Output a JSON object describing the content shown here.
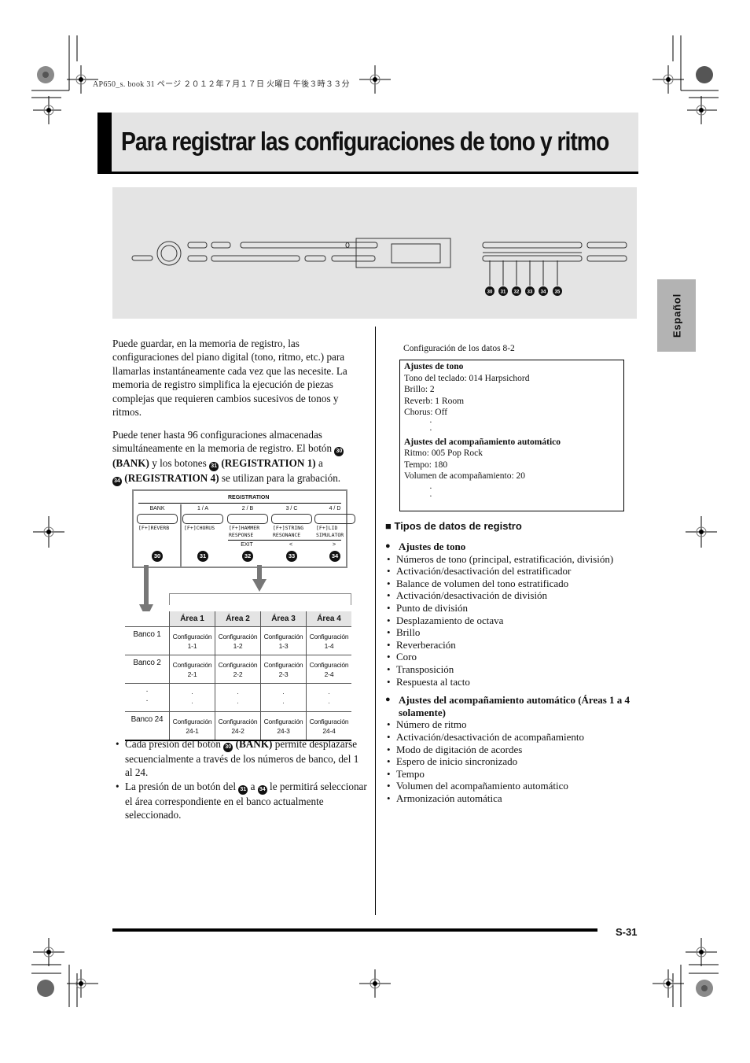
{
  "print_header": "AP650_s. book  31 ページ  ２０１２年７月１７日  火曜日  午後３時３３分",
  "title": "Para registrar las configuraciones de tono y ritmo",
  "side_tab": "Español",
  "panel_callouts": [
    "30",
    "31",
    "32",
    "33",
    "34",
    "35"
  ],
  "left": {
    "intro": "Puede guardar, en la memoria de registro, las configuraciones del piano digital (tono, ritmo, etc.) para llamarlas instantáneamente cada vez que las necesite. La memoria de registro simplifica la ejecución de piezas complejas que requieren cambios sucesivos de tonos y ritmos.",
    "para2": {
      "text1": "Puede tener hasta 96 configuraciones almacenadas simultáneamente en la memoria de registro. El botón ",
      "num1": "30",
      "bold1": "(BANK)",
      "text2": " y los botones ",
      "num2": "31",
      "bold2": "(REGISTRATION 1)",
      "text3": " a ",
      "num3": "34",
      "bold3": "(REGISTRATION 4)",
      "text4": " se utilizan para la grabación."
    },
    "figure": {
      "registration_label": "REGISTRATION",
      "columns": [
        {
          "label": "BANK",
          "function": "[F+]REVERB",
          "sub": "",
          "num": "30"
        },
        {
          "label": "1 / A",
          "function": "[F+]CHORUS",
          "sub": "",
          "num": "31"
        },
        {
          "label": "2 / B",
          "function": "[F+]HAMMER\nRESPONSE",
          "sub": "EXIT",
          "num": "32"
        },
        {
          "label": "3 / C",
          "function": "[F+]STRING\nRESONANCE",
          "sub": "<",
          "num": "33"
        },
        {
          "label": "4 / D",
          "function": "[F+]LID\nSIMULATOR",
          "sub": ">",
          "num": "34"
        }
      ]
    },
    "table": {
      "headers": [
        "Área 1",
        "Área 2",
        "Área 3",
        "Área 4"
      ],
      "rows": [
        {
          "bank": "Banco 1",
          "cells": [
            "Configuración\n1-1",
            "Configuración\n1-2",
            "Configuración\n1-3",
            "Configuración\n1-4"
          ]
        },
        {
          "bank": "Banco 2",
          "cells": [
            "Configuración\n2-1",
            "Configuración\n2-2",
            "Configuración\n2-3",
            "Configuración\n2-4"
          ]
        },
        {
          "bank": "·\n·",
          "cells": [
            "·\n·",
            "·\n·",
            "·\n·",
            "·\n·"
          ]
        },
        {
          "bank": "Banco 24",
          "cells": [
            "Configuración\n24-1",
            "Configuración\n24-2",
            "Configuración\n24-3",
            "Configuración\n24-4"
          ]
        }
      ]
    },
    "notes": [
      {
        "pre": "Cada presión del botón ",
        "num": "30",
        "bold": "(BANK)",
        "post": " permite desplazarse secuencialmente a través de los números de banco, del 1 al 24."
      },
      {
        "pre": "La presión de un botón del ",
        "num": "31",
        "mid": " a ",
        "num2": "34",
        "post": " le permitirá seleccionar el área correspondiente en el banco actualmente seleccionado."
      }
    ]
  },
  "right": {
    "example_caption": "Configuración de los datos 8-2",
    "example_box": {
      "tone_heading": "Ajustes de tono",
      "tone_lines": [
        "Tono del teclado: 014 Harpsichord",
        "Brillo: 2",
        "Reverb: 1 Room",
        "Chorus: Off"
      ],
      "accomp_heading": "Ajustes del acompañamiento automático",
      "accomp_lines": [
        "Ritmo: 005 Pop Rock",
        "Tempo: 180",
        "Volumen de acompañamiento: 20"
      ],
      "ellipsis": "·"
    },
    "section_heading": "Tipos de datos de registro",
    "groups": [
      {
        "title": "Ajustes de tono",
        "items": [
          "Números de tono (principal, estratificación, división)",
          "Activación/desactivación del estratificador",
          "Balance de volumen del tono estratificado",
          "Activación/desactivación de división",
          "Punto de división",
          "Desplazamiento de octava",
          "Brillo",
          "Reverberación",
          "Coro",
          "Transposición",
          "Respuesta al tacto"
        ]
      },
      {
        "title": "Ajustes del acompañamiento automático (Áreas 1 a 4 solamente)",
        "items": [
          "Número de ritmo",
          "Activación/desactivación de acompañamiento",
          "Modo de digitación de acordes",
          "Espero de inicio sincronizado",
          "Tempo",
          "Volumen del acompañamiento automático",
          "Armonización automática"
        ]
      }
    ]
  },
  "page_number": "S-31"
}
